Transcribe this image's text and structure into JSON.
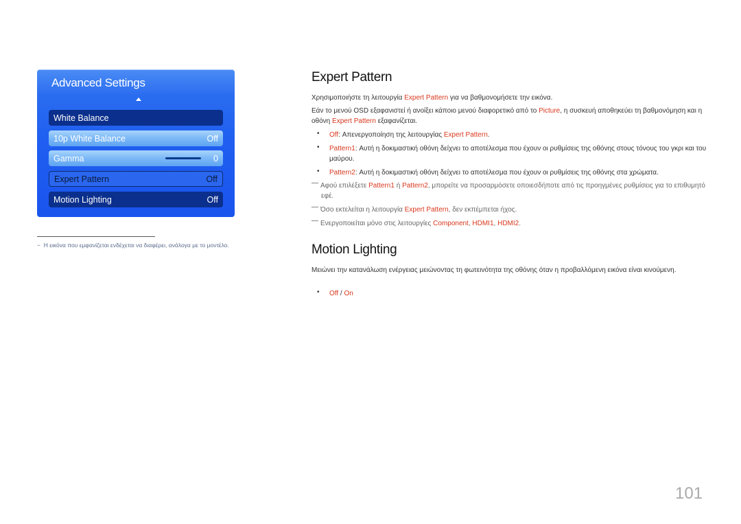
{
  "osd": {
    "title": "Advanced Settings",
    "items": [
      {
        "label": "White Balance",
        "value": ""
      },
      {
        "label": "10p White Balance",
        "value": "Off"
      },
      {
        "label": "Gamma",
        "value": "0"
      },
      {
        "label": "Expert Pattern",
        "value": "Off"
      },
      {
        "label": "Motion Lighting",
        "value": "Off"
      }
    ]
  },
  "footnote": "Η εικόνα που εμφανίζεται ενδέχεται να διαφέρει, ανάλογα με το μοντέλο.",
  "expert": {
    "heading": "Expert Pattern",
    "intro": [
      "Χρησιμοποιήστε τη λειτουργία ",
      "Expert Pattern",
      " για να βαθμονομήσετε την εικόνα."
    ],
    "para": [
      "Εάν το μενού OSD εξαφανιστεί ή ανοίξει κάποιο μενού διαφορετικό από το ",
      "Picture",
      ", η συσκευή αποθηκεύει τη βαθμονόμηση και η οθόνη ",
      "Expert Pattern",
      " εξαφανίζεται."
    ],
    "bullets": [
      {
        "term": "Off",
        "text1": ": Απενεργοποίηση της λειτουργίας ",
        "term2": "Expert Pattern",
        "text2": "."
      },
      {
        "term": "Pattern1",
        "text1": ": Αυτή η δοκιμαστική οθόνη δείχνει το αποτέλεσμα που έχουν οι ρυθμίσεις της οθόνης στους τόνους του γκρι και του μαύρου."
      },
      {
        "term": "Pattern2",
        "text1": ": Αυτή η δοκιμαστική οθόνη δείχνει το αποτέλεσμα που έχουν οι ρυθμίσεις της οθόνης στα χρώματα."
      }
    ],
    "notes": [
      [
        "Αφού επιλέξετε ",
        "Pattern1",
        " ή ",
        "Pattern2",
        ", μπορείτε να προσαρμόσετε οποιεσδήποτε από τις προηγμένες ρυθμίσεις για το επιθυμητό εφέ."
      ],
      [
        "Όσο εκτελείται η λειτουργία ",
        "Expert Pattern",
        ", δεν εκπέμπεται ήχος."
      ],
      [
        "Ενεργοποιείται μόνο στις λειτουργίες ",
        "Component",
        ", ",
        "HDMI1",
        ", ",
        "HDMI2",
        "."
      ]
    ]
  },
  "motion": {
    "heading": "Motion Lighting",
    "para": "Μειώνει την κατανάλωση ενέργειας μειώνοντας τη φωτεινότητα της οθόνης όταν η προβαλλόμενη εικόνα είναι κινούμενη.",
    "options": [
      "Off",
      " / ",
      "On"
    ]
  },
  "page_number": "101",
  "colors": {
    "highlight": "#d8371c",
    "osd_blue": "#1f5ef0",
    "osd_dark": "#0b2f8c"
  }
}
